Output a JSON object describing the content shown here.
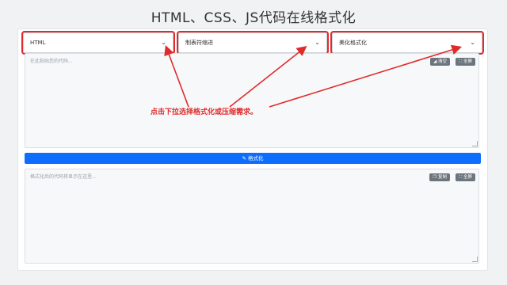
{
  "page": {
    "title": "HTML、CSS、JS代码在线格式化"
  },
  "selects": {
    "language": "HTML",
    "indent": "制表符缩进",
    "mode": "美化格式化"
  },
  "input": {
    "placeholder": "在此粘贴您的代码...",
    "clear_label": "清空",
    "fullscreen_label": "全屏"
  },
  "format_button": {
    "label": "格式化"
  },
  "output": {
    "placeholder": "格式化后的代码将显示在这里...",
    "copy_label": "复制",
    "fullscreen_label": "全屏"
  },
  "annotation": {
    "text": "点击下拉选择格式化或压缩需求。"
  },
  "colors": {
    "accent": "#0d6efd",
    "annotation": "#e02b2b",
    "secondary": "#6c757d"
  },
  "icons": [
    "chevron-down-icon",
    "eraser-icon",
    "expand-icon",
    "pen-icon",
    "copy-icon"
  ]
}
